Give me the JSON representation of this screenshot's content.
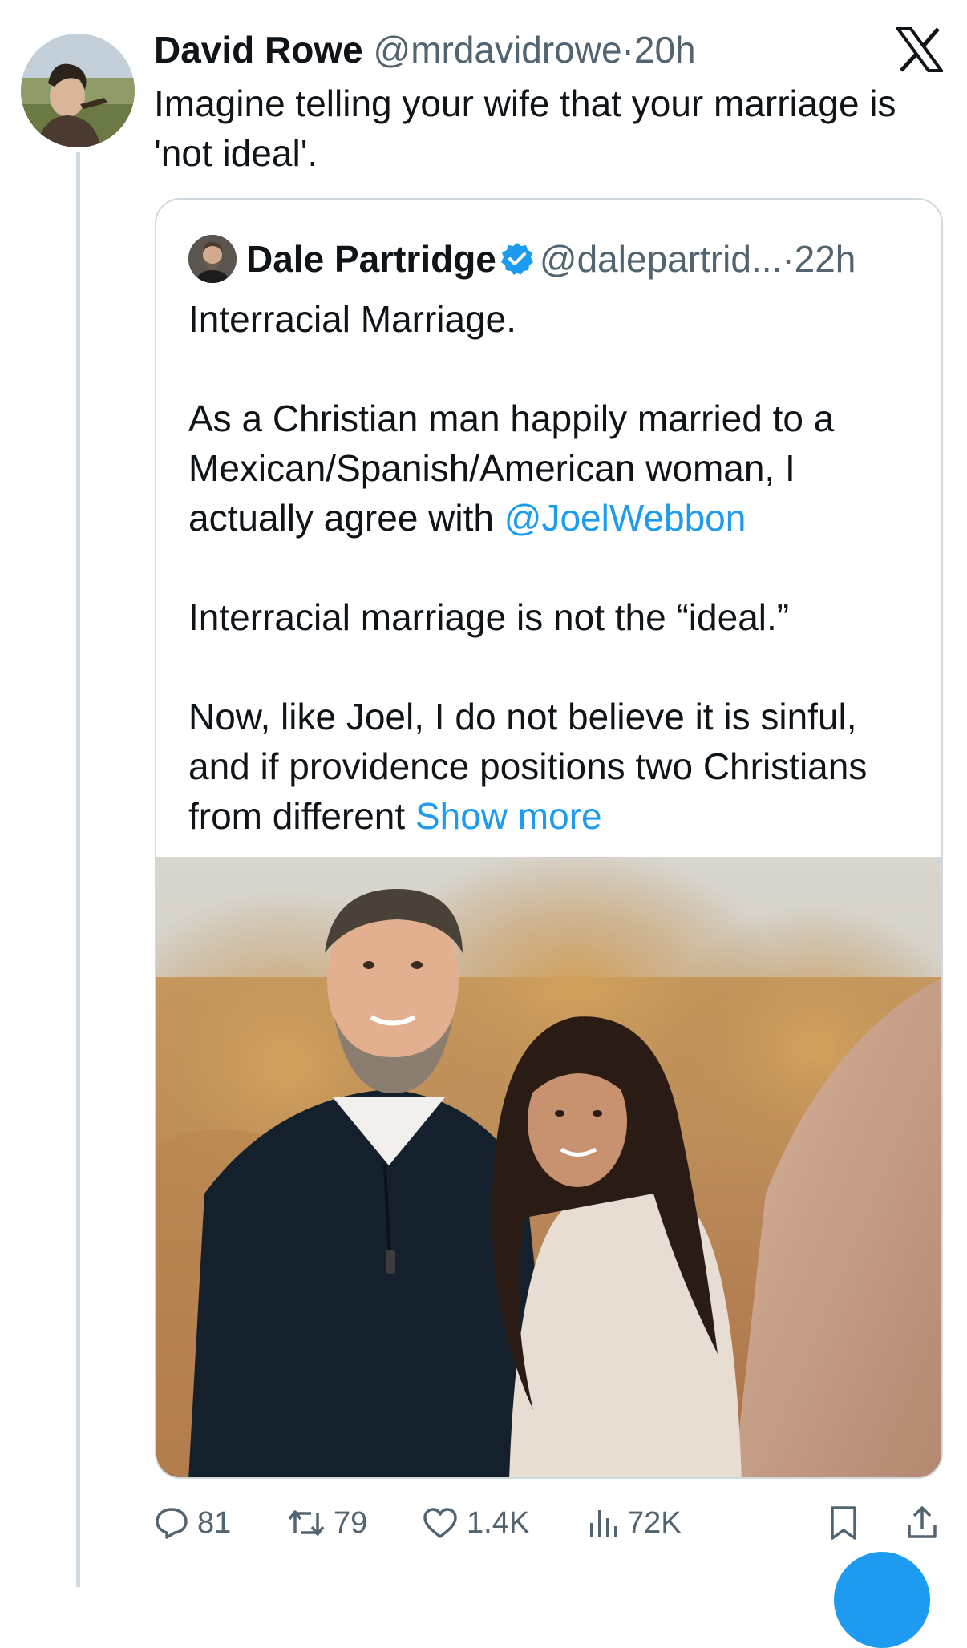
{
  "tweet": {
    "author_name": "David Rowe",
    "author_handle": "@mrdavidrowe",
    "separator": "·",
    "time": "20h",
    "text": "Imagine telling your wife that your marriage is 'not ideal'.",
    "avatar_icon": "user-avatar-photo"
  },
  "quote": {
    "author_name": "Dale Partridge",
    "author_handle": "@dalepartrid...",
    "separator": "·",
    "time": "22h",
    "verified_icon": "verified-badge-icon",
    "paragraph_1": "Interracial Marriage.",
    "paragraph_2_prefix": "As a Christian man happily married to a Mexican/Spanish/American woman, I actually agree with ",
    "mention": "@JoelWebbon",
    "paragraph_3": "Interracial marriage is not the “ideal.”",
    "paragraph_4_prefix": "Now, like Joel, I do not believe it is sinful, and if providence positions two Christians from different ",
    "show_more": "Show more",
    "image_icon": "couple-photo"
  },
  "actions": {
    "replies": "81",
    "retweets": "79",
    "likes": "1.4K",
    "views": "72K"
  },
  "colors": {
    "link": "#1d9bf0",
    "secondary_text": "#536471",
    "primary_text": "#0f1419",
    "border": "#cfd9de"
  }
}
